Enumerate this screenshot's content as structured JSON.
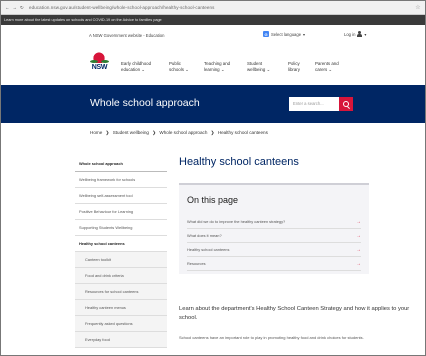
{
  "browser": {
    "url": "education.nsw.gov.au/student-wellbeing/whole-school-approach/healthy-school-canteens"
  },
  "covid_banner": "Learn more about the latest updates on schools and COVID-19 on the Advice to families page",
  "utility": {
    "gov_link": "A NSW Government website - Education",
    "language_label": "Select language",
    "login_label": "Log in"
  },
  "logo_text": "NSW",
  "primary_nav": [
    {
      "line1": "Early childhood",
      "line2": "education"
    },
    {
      "line1": "Public",
      "line2": "schools"
    },
    {
      "line1": "Teaching and",
      "line2": "learning"
    },
    {
      "line1": "Student",
      "line2": "wellbeing"
    },
    {
      "line1": "Policy",
      "line2": "library"
    },
    {
      "line1": "Parents and",
      "line2": "carers"
    }
  ],
  "section": {
    "title": "Whole school approach",
    "search_placeholder": "Enter a search..."
  },
  "breadcrumb": [
    "Home",
    "Student wellbeing",
    "Whole school approach",
    "Healthy school canteens"
  ],
  "sidebar": [
    {
      "label": "Whole school approach",
      "kind": "head"
    },
    {
      "label": "Wellbeing framework for schools",
      "kind": "item"
    },
    {
      "label": "Wellbeing self-assessment tool",
      "kind": "item"
    },
    {
      "label": "Positive Behaviour for Learning",
      "kind": "item"
    },
    {
      "label": "Supporting Students Wellbeing",
      "kind": "item"
    },
    {
      "label": "Healthy school canteens",
      "kind": "active"
    },
    {
      "label": "Canteen toolkit",
      "kind": "sub"
    },
    {
      "label": "Food and drink criteria",
      "kind": "sub"
    },
    {
      "label": "Resources for school canteens",
      "kind": "sub"
    },
    {
      "label": "Healthy canteen menus",
      "kind": "sub"
    },
    {
      "label": "Frequently asked questions",
      "kind": "sub"
    },
    {
      "label": "Everyday food",
      "kind": "sub"
    }
  ],
  "main": {
    "page_title": "Healthy school canteens",
    "on_this_page_title": "On this page",
    "toc": [
      "What did we do to improve the healthy canteen strategy?",
      "What does it mean?",
      "Healthy school canteens",
      "Resources"
    ],
    "lead": "Learn about the department's Healthy School Canteen Strategy and how it applies to your school.",
    "body": "School canteens have an important role to play in promoting healthy food and drink choices for students."
  }
}
